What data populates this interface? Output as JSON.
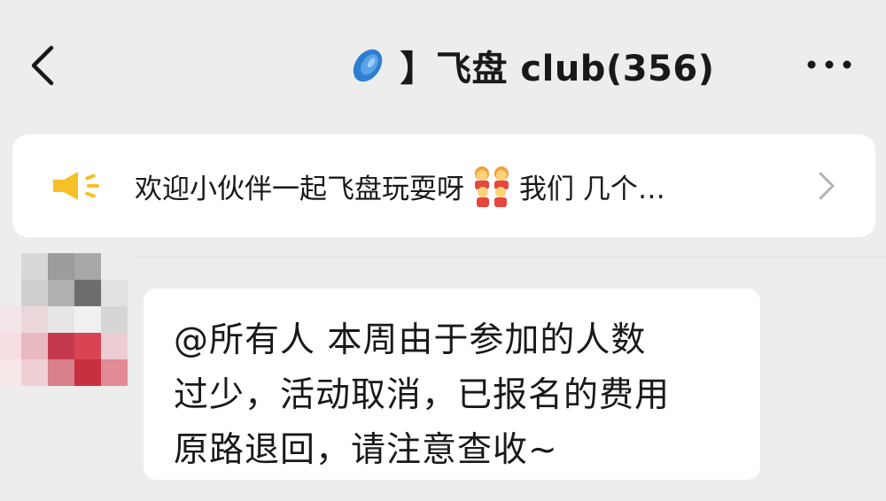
{
  "header": {
    "title": "】飞盘 club(356)",
    "back_icon": "chevron-left-icon",
    "group_icon": "frisbee-icon",
    "more_icon": "more-dots-icon"
  },
  "notice": {
    "icon": "speaker-icon",
    "text_before": "欢迎小伙伴一起飞盘玩耍呀",
    "emoji": "family-emoji",
    "text_after": "我们 几个…",
    "chevron": "chevron-right-icon"
  },
  "message": {
    "avatar": "pixelated-avatar",
    "lines": [
      "@所有人  本周由于参加的人数",
      "过少，活动取消，已报名的费用",
      "原路退回，请注意查收~"
    ]
  },
  "colors": {
    "background": "#ededed",
    "bubble": "#ffffff",
    "speaker": "#f6c026",
    "frisbee": "#2e7fd1"
  }
}
